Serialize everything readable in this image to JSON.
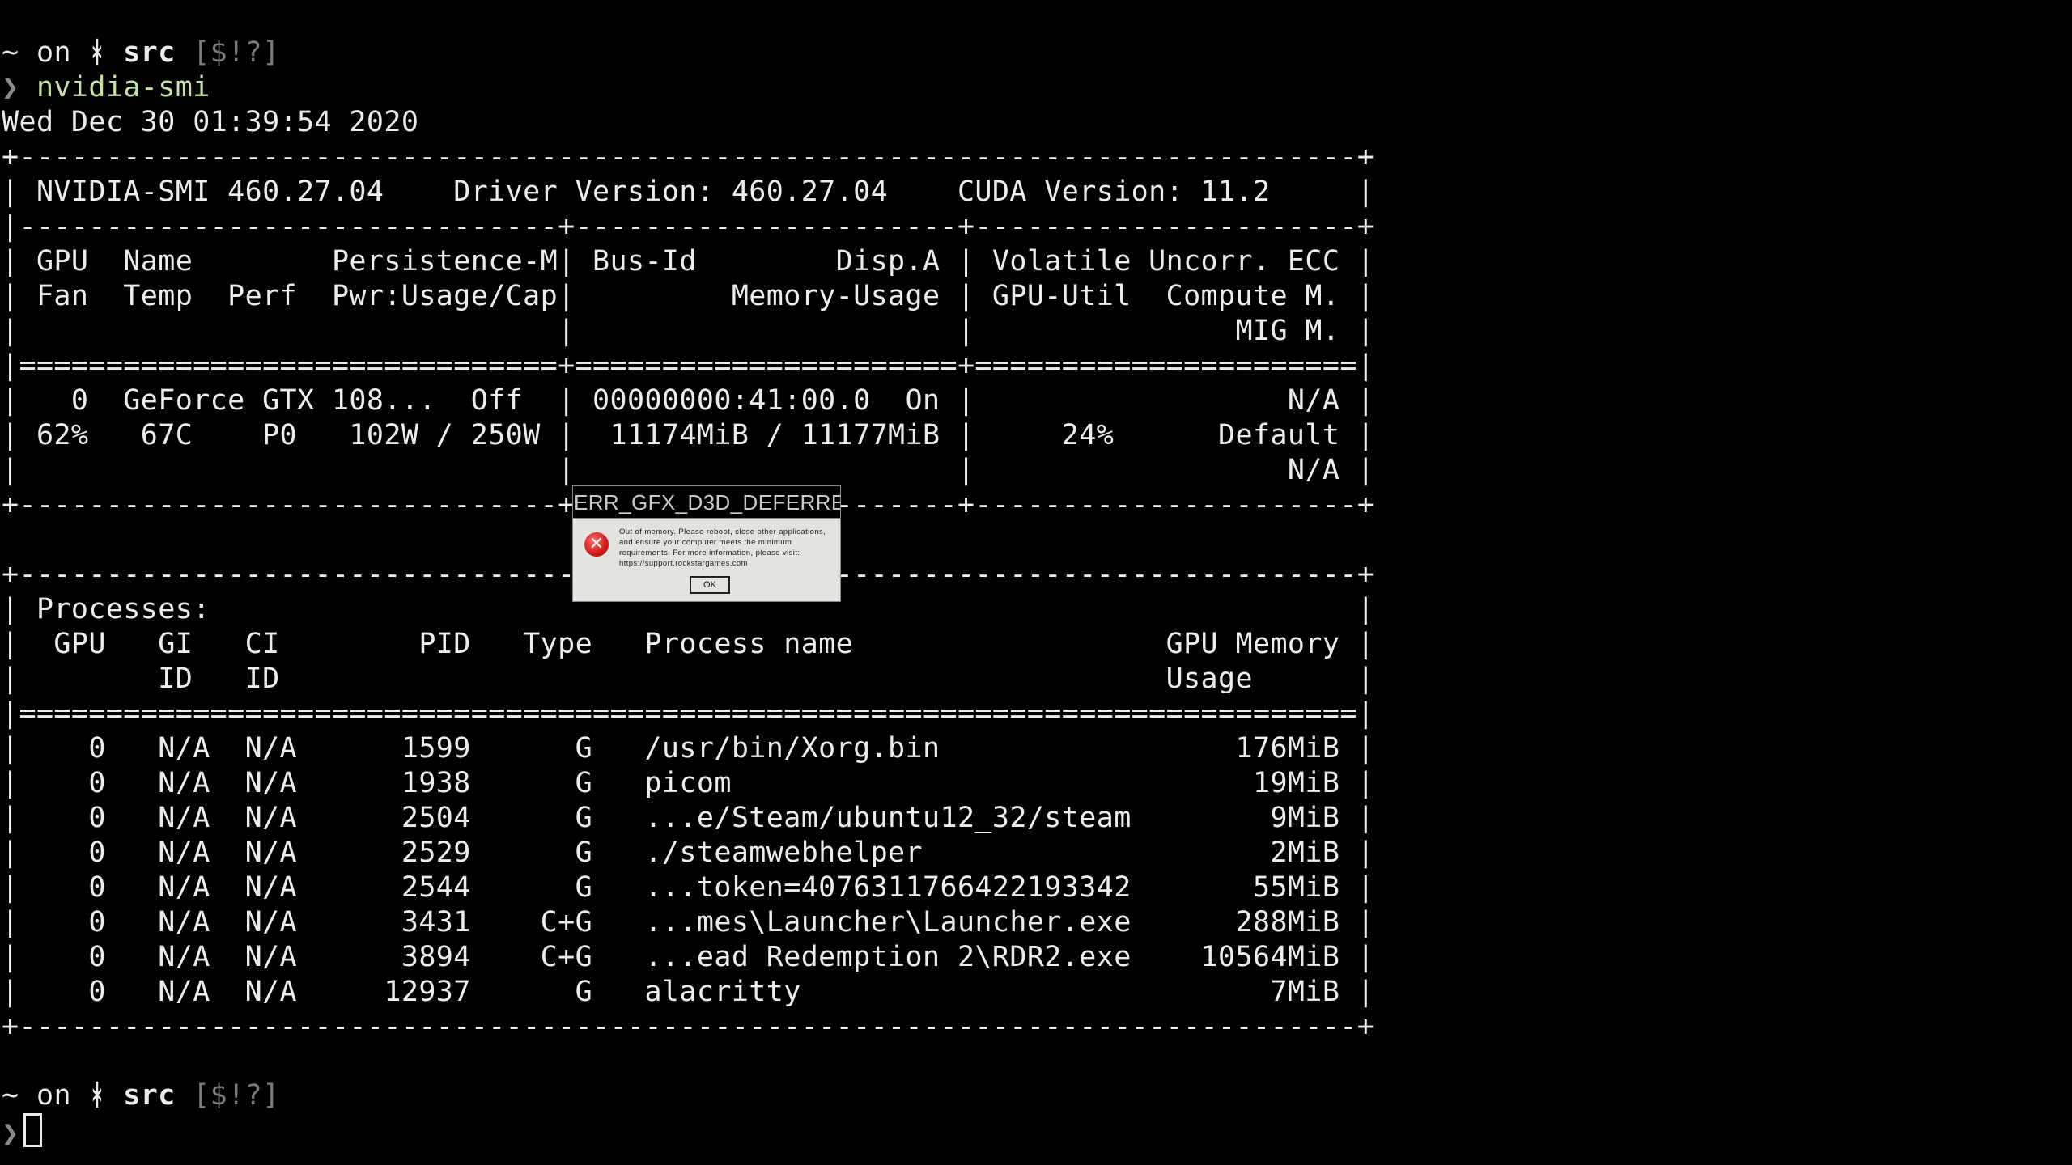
{
  "prompt": {
    "home": "~",
    "on": "on",
    "branch_icon": "ᚼ",
    "dir": "src",
    "status": "[$!?]",
    "arrow": "❯"
  },
  "command": "nvidia-smi",
  "date_line": "Wed Dec 30 01:39:54 2020",
  "smi_lines": [
    "+-----------------------------------------------------------------------------+",
    "| NVIDIA-SMI 460.27.04    Driver Version: 460.27.04    CUDA Version: 11.2     |",
    "|-------------------------------+----------------------+----------------------+",
    "| GPU  Name        Persistence-M| Bus-Id        Disp.A | Volatile Uncorr. ECC |",
    "| Fan  Temp  Perf  Pwr:Usage/Cap|         Memory-Usage | GPU-Util  Compute M. |",
    "|                               |                      |               MIG M. |",
    "|===============================+======================+======================|",
    "|   0  GeForce GTX 108...  Off  | 00000000:41:00.0  On |                  N/A |",
    "| 62%   67C    P0   102W / 250W |  11174MiB / 11177MiB |     24%      Default |",
    "|                               |                      |                  N/A |",
    "+-------------------------------+----------------------+----------------------+",
    "",
    "+-----------------------------------------------------------------------------+",
    "| Processes:                                                                  |",
    "|  GPU   GI   CI        PID   Type   Process name                  GPU Memory |",
    "|        ID   ID                                                   Usage      |",
    "|=============================================================================|",
    "|    0   N/A  N/A      1599      G   /usr/bin/Xorg.bin                 176MiB |",
    "|    0   N/A  N/A      1938      G   picom                              19MiB |",
    "|    0   N/A  N/A      2504      G   ...e/Steam/ubuntu12_32/steam        9MiB |",
    "|    0   N/A  N/A      2529      G   ./steamwebhelper                    2MiB |",
    "|    0   N/A  N/A      2544      G   ...token=4076311766422193342       55MiB |",
    "|    0   N/A  N/A      3431    C+G   ...mes\\Launcher\\Launcher.exe      288MiB |",
    "|    0   N/A  N/A      3894    C+G   ...ead Redemption 2\\RDR2.exe    10564MiB |",
    "|    0   N/A  N/A     12937      G   alacritty                           7MiB |",
    "+-----------------------------------------------------------------------------+"
  ],
  "dialog": {
    "title": "ERR_GFX_D3D_DEFERRE...",
    "message": "Out of memory. Please reboot, close other applications, and ensure your computer meets the minimum requirements. For more information, please visit: https://support.rockstargames.com",
    "ok_label": "OK",
    "icon": "error-icon"
  }
}
